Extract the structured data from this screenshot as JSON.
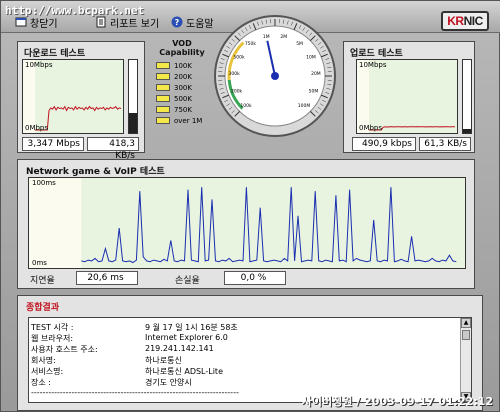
{
  "watermark": "http://www.bcpark.net",
  "toolbar": {
    "close_label": "창닫기",
    "report_label": "리포트 보기",
    "help_label": "도움말"
  },
  "logo": {
    "text_red": "KR",
    "text_dark": "NIC"
  },
  "download": {
    "title": "다운로드 테스트",
    "scale_top": "10Mbps",
    "scale_bottom": "0Mbps",
    "speed_mbps": "3,347 Mbps",
    "speed_kbs": "418,3 KB/s",
    "meter_fraction": 0.28,
    "trace": [
      0,
      0,
      0,
      0,
      0,
      0,
      0,
      0,
      3.0,
      3.4,
      3.2,
      3.6,
      3.1,
      3.5,
      3.3,
      3.4,
      3.2,
      3.6,
      3.0,
      3.5,
      3.3,
      3.4,
      3.1,
      3.6,
      3.2,
      3.5,
      3.3,
      3.4,
      3.1,
      3.5,
      3.2,
      3.6,
      3.3,
      3.4,
      3.0,
      3.5,
      3.2,
      3.4,
      3.3,
      3.5,
      3.1,
      3.4,
      3.2,
      3.5,
      3.3,
      3.4,
      3.6,
      3.2,
      3.4,
      3.3
    ]
  },
  "vod": {
    "title": "VOD Capability",
    "levels": [
      "100K",
      "200K",
      "300K",
      "500K",
      "750K",
      "over 1M"
    ]
  },
  "gauge": {
    "tick_labels": [
      "100k",
      "200k",
      "300k",
      "500k",
      "750k",
      "1M",
      "2M",
      "5M",
      "10M",
      "20M",
      "50M",
      "100M"
    ],
    "needle_label": "1M"
  },
  "upload": {
    "title": "업로드 테스트",
    "scale_top": "10Mbps",
    "scale_bottom": "0Mbps",
    "speed_mbps": "490,9 kbps",
    "speed_kbs": "61,3 KB/s",
    "meter_fraction": 0.06,
    "trace": [
      0,
      0,
      0,
      0,
      0,
      0,
      0,
      0,
      0.4,
      0.5,
      0.45,
      0.5,
      0.48,
      0.52,
      0.46,
      0.5,
      0.49,
      0.51,
      0.47,
      0.5,
      0.48,
      0.53,
      0.46,
      0.5,
      0.49,
      0.5,
      0.47,
      0.52,
      0.48,
      0.5,
      0.49,
      0.51,
      0.47,
      0.5,
      0.48,
      0.52,
      0.46,
      0.5,
      0.49,
      0.51,
      0.48,
      0.5,
      0.47,
      0.52,
      0.49,
      0.5,
      0.48,
      0.51,
      0.5,
      0.49
    ]
  },
  "network": {
    "title": "Network game & VoIP 테스트",
    "scale_top": "100ms",
    "scale_bottom": "0ms",
    "latency_label": "지연율",
    "latency_value": "20,6 ms",
    "loss_label": "손실율",
    "loss_value": "0,0 %",
    "trace": [
      5,
      4,
      6,
      5,
      8,
      4,
      5,
      20,
      5,
      4,
      6,
      45,
      5,
      4,
      5,
      3,
      6,
      90,
      10,
      5,
      4,
      6,
      5,
      4,
      7,
      5,
      30,
      5,
      4,
      6,
      5,
      92,
      6,
      5,
      4,
      95,
      5,
      6,
      80,
      5,
      4,
      6,
      5,
      8,
      4,
      5,
      6,
      5,
      95,
      4,
      5,
      6,
      70,
      5,
      4,
      5,
      6,
      5,
      4,
      8,
      5,
      95,
      5,
      60,
      4,
      5,
      6,
      5,
      90,
      5,
      4,
      6,
      5,
      4,
      85,
      5,
      6,
      4,
      92,
      5,
      8,
      6,
      5,
      4,
      5,
      55,
      5,
      4,
      6,
      5,
      95,
      4,
      5,
      7,
      5,
      4,
      35,
      5,
      6,
      5,
      4,
      5,
      8,
      5,
      4,
      6,
      5,
      12,
      5,
      4
    ]
  },
  "summary": {
    "title": "종합결과",
    "lines": [
      {
        "label": "TEST 시각 :",
        "value": "9 월 17 일  1시 16분 58초"
      },
      {
        "label": "웹 브라우저:",
        "value": "Internet Explorer 6.0"
      },
      {
        "label": "사용자 호스트 주소:",
        "value": "219.241.142.141"
      },
      {
        "label": "회사명:",
        "value": "하나로통신"
      },
      {
        "label": "서비스명:",
        "value": "하나로통신 ADSL-Lite"
      },
      {
        "label": "장소 :",
        "value": "경기도 안양시"
      }
    ],
    "divider": "------------------------------------------------------------------------"
  },
  "stamp": "사이버정원 / 2003-09-17 01:22:12"
}
